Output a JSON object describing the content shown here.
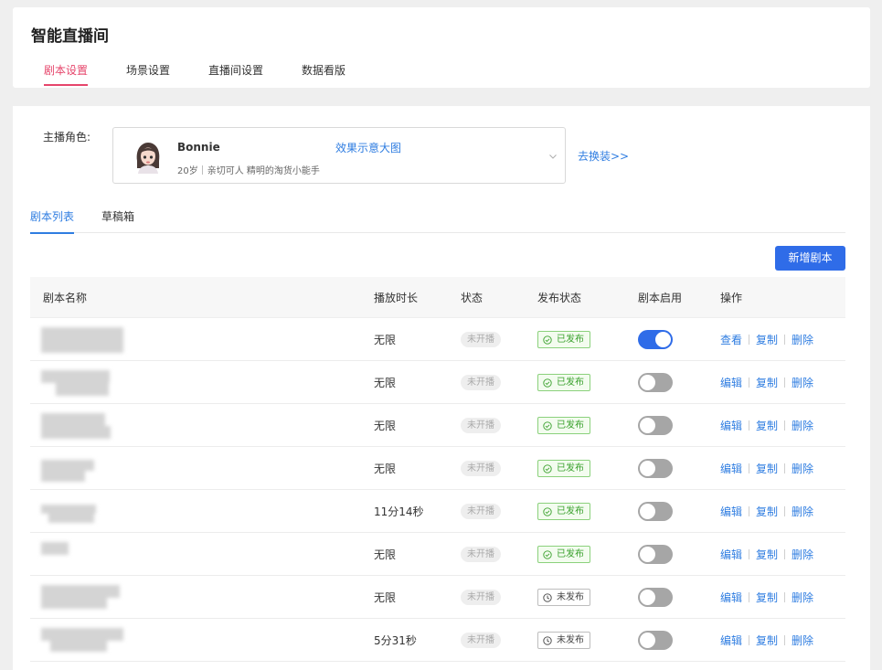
{
  "header": {
    "title": "智能直播间",
    "tabs": [
      "剧本设置",
      "场景设置",
      "直播间设置",
      "数据看版"
    ]
  },
  "anchor": {
    "label": "主播角色:",
    "name": "Bonnie",
    "description": "20岁｜亲切可人 精明的淘货小能手",
    "effect_link": "效果示意大图",
    "change_link": "去换装>>"
  },
  "sub_tabs": [
    "剧本列表",
    "草稿箱"
  ],
  "new_button": "新增剧本",
  "table": {
    "columns": [
      "剧本名称",
      "播放时长",
      "状态",
      "发布状态",
      "剧本启用",
      "操作"
    ],
    "rows": [
      {
        "duration": "无限",
        "status": "未开播",
        "publish": "已发布",
        "published": true,
        "enabled": true,
        "ops": [
          "查看",
          "复制",
          "删除"
        ]
      },
      {
        "duration": "无限",
        "status": "未开播",
        "publish": "已发布",
        "published": true,
        "enabled": false,
        "ops": [
          "编辑",
          "复制",
          "删除"
        ]
      },
      {
        "duration": "无限",
        "status": "未开播",
        "publish": "已发布",
        "published": true,
        "enabled": false,
        "ops": [
          "编辑",
          "复制",
          "删除"
        ]
      },
      {
        "duration": "无限",
        "status": "未开播",
        "publish": "已发布",
        "published": true,
        "enabled": false,
        "ops": [
          "编辑",
          "复制",
          "删除"
        ]
      },
      {
        "duration": "11分14秒",
        "status": "未开播",
        "publish": "已发布",
        "published": true,
        "enabled": false,
        "ops": [
          "编辑",
          "复制",
          "删除"
        ]
      },
      {
        "duration": "无限",
        "status": "未开播",
        "publish": "已发布",
        "published": true,
        "enabled": false,
        "ops": [
          "编辑",
          "复制",
          "删除"
        ]
      },
      {
        "duration": "无限",
        "status": "未开播",
        "publish": "未发布",
        "published": false,
        "enabled": false,
        "ops": [
          "编辑",
          "复制",
          "删除"
        ]
      },
      {
        "duration": "5分31秒",
        "status": "未开播",
        "publish": "未发布",
        "published": false,
        "enabled": false,
        "ops": [
          "编辑",
          "复制",
          "删除"
        ]
      }
    ]
  },
  "colors": {
    "accent_red": "#e6456b",
    "link_blue": "#2f7de1",
    "primary_blue": "#2f6ce8",
    "published_green": "#3aa12d"
  }
}
